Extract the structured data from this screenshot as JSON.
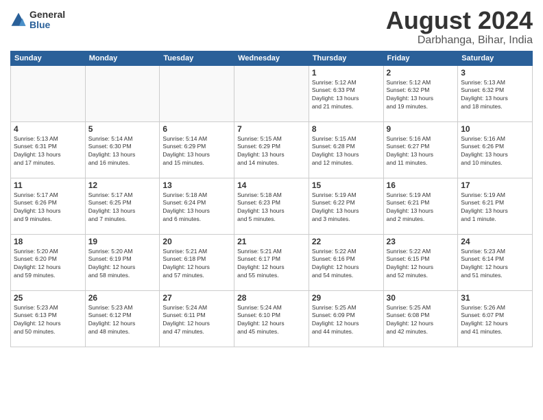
{
  "header": {
    "logo_general": "General",
    "logo_blue": "Blue",
    "month_title": "August 2024",
    "subtitle": "Darbhanga, Bihar, India"
  },
  "weekdays": [
    "Sunday",
    "Monday",
    "Tuesday",
    "Wednesday",
    "Thursday",
    "Friday",
    "Saturday"
  ],
  "weeks": [
    [
      {
        "day": "",
        "info": ""
      },
      {
        "day": "",
        "info": ""
      },
      {
        "day": "",
        "info": ""
      },
      {
        "day": "",
        "info": ""
      },
      {
        "day": "1",
        "info": "Sunrise: 5:12 AM\nSunset: 6:33 PM\nDaylight: 13 hours\nand 21 minutes."
      },
      {
        "day": "2",
        "info": "Sunrise: 5:12 AM\nSunset: 6:32 PM\nDaylight: 13 hours\nand 19 minutes."
      },
      {
        "day": "3",
        "info": "Sunrise: 5:13 AM\nSunset: 6:32 PM\nDaylight: 13 hours\nand 18 minutes."
      }
    ],
    [
      {
        "day": "4",
        "info": "Sunrise: 5:13 AM\nSunset: 6:31 PM\nDaylight: 13 hours\nand 17 minutes."
      },
      {
        "day": "5",
        "info": "Sunrise: 5:14 AM\nSunset: 6:30 PM\nDaylight: 13 hours\nand 16 minutes."
      },
      {
        "day": "6",
        "info": "Sunrise: 5:14 AM\nSunset: 6:29 PM\nDaylight: 13 hours\nand 15 minutes."
      },
      {
        "day": "7",
        "info": "Sunrise: 5:15 AM\nSunset: 6:29 PM\nDaylight: 13 hours\nand 14 minutes."
      },
      {
        "day": "8",
        "info": "Sunrise: 5:15 AM\nSunset: 6:28 PM\nDaylight: 13 hours\nand 12 minutes."
      },
      {
        "day": "9",
        "info": "Sunrise: 5:16 AM\nSunset: 6:27 PM\nDaylight: 13 hours\nand 11 minutes."
      },
      {
        "day": "10",
        "info": "Sunrise: 5:16 AM\nSunset: 6:26 PM\nDaylight: 13 hours\nand 10 minutes."
      }
    ],
    [
      {
        "day": "11",
        "info": "Sunrise: 5:17 AM\nSunset: 6:26 PM\nDaylight: 13 hours\nand 9 minutes."
      },
      {
        "day": "12",
        "info": "Sunrise: 5:17 AM\nSunset: 6:25 PM\nDaylight: 13 hours\nand 7 minutes."
      },
      {
        "day": "13",
        "info": "Sunrise: 5:18 AM\nSunset: 6:24 PM\nDaylight: 13 hours\nand 6 minutes."
      },
      {
        "day": "14",
        "info": "Sunrise: 5:18 AM\nSunset: 6:23 PM\nDaylight: 13 hours\nand 5 minutes."
      },
      {
        "day": "15",
        "info": "Sunrise: 5:19 AM\nSunset: 6:22 PM\nDaylight: 13 hours\nand 3 minutes."
      },
      {
        "day": "16",
        "info": "Sunrise: 5:19 AM\nSunset: 6:21 PM\nDaylight: 13 hours\nand 2 minutes."
      },
      {
        "day": "17",
        "info": "Sunrise: 5:19 AM\nSunset: 6:21 PM\nDaylight: 13 hours\nand 1 minute."
      }
    ],
    [
      {
        "day": "18",
        "info": "Sunrise: 5:20 AM\nSunset: 6:20 PM\nDaylight: 12 hours\nand 59 minutes."
      },
      {
        "day": "19",
        "info": "Sunrise: 5:20 AM\nSunset: 6:19 PM\nDaylight: 12 hours\nand 58 minutes."
      },
      {
        "day": "20",
        "info": "Sunrise: 5:21 AM\nSunset: 6:18 PM\nDaylight: 12 hours\nand 57 minutes."
      },
      {
        "day": "21",
        "info": "Sunrise: 5:21 AM\nSunset: 6:17 PM\nDaylight: 12 hours\nand 55 minutes."
      },
      {
        "day": "22",
        "info": "Sunrise: 5:22 AM\nSunset: 6:16 PM\nDaylight: 12 hours\nand 54 minutes."
      },
      {
        "day": "23",
        "info": "Sunrise: 5:22 AM\nSunset: 6:15 PM\nDaylight: 12 hours\nand 52 minutes."
      },
      {
        "day": "24",
        "info": "Sunrise: 5:23 AM\nSunset: 6:14 PM\nDaylight: 12 hours\nand 51 minutes."
      }
    ],
    [
      {
        "day": "25",
        "info": "Sunrise: 5:23 AM\nSunset: 6:13 PM\nDaylight: 12 hours\nand 50 minutes."
      },
      {
        "day": "26",
        "info": "Sunrise: 5:23 AM\nSunset: 6:12 PM\nDaylight: 12 hours\nand 48 minutes."
      },
      {
        "day": "27",
        "info": "Sunrise: 5:24 AM\nSunset: 6:11 PM\nDaylight: 12 hours\nand 47 minutes."
      },
      {
        "day": "28",
        "info": "Sunrise: 5:24 AM\nSunset: 6:10 PM\nDaylight: 12 hours\nand 45 minutes."
      },
      {
        "day": "29",
        "info": "Sunrise: 5:25 AM\nSunset: 6:09 PM\nDaylight: 12 hours\nand 44 minutes."
      },
      {
        "day": "30",
        "info": "Sunrise: 5:25 AM\nSunset: 6:08 PM\nDaylight: 12 hours\nand 42 minutes."
      },
      {
        "day": "31",
        "info": "Sunrise: 5:26 AM\nSunset: 6:07 PM\nDaylight: 12 hours\nand 41 minutes."
      }
    ]
  ]
}
